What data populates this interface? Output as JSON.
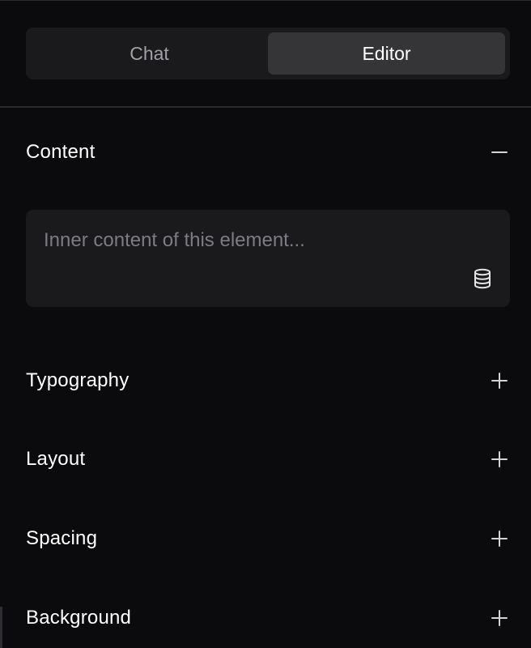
{
  "tabs": [
    {
      "label": "Chat",
      "active": false
    },
    {
      "label": "Editor",
      "active": true
    }
  ],
  "sections": {
    "content": {
      "title": "Content",
      "expanded": true,
      "toggle_icon": "minus-icon"
    },
    "typography": {
      "title": "Typography",
      "expanded": false,
      "toggle_icon": "plus-icon"
    },
    "layout": {
      "title": "Layout",
      "expanded": false,
      "toggle_icon": "plus-icon"
    },
    "spacing": {
      "title": "Spacing",
      "expanded": false,
      "toggle_icon": "plus-icon"
    },
    "background": {
      "title": "Background",
      "expanded": false,
      "toggle_icon": "plus-icon"
    }
  },
  "content_field": {
    "placeholder": "Inner content of this element...",
    "value": "",
    "action_icon": "database-icon"
  },
  "colors": {
    "background": "#0b0b0d",
    "surface": "#1a1a1c",
    "active_tab": "#353538",
    "text": "#ffffff",
    "muted_text": "#a1a1a6",
    "placeholder": "#7c7c82",
    "divider": "#2a2a2e"
  }
}
